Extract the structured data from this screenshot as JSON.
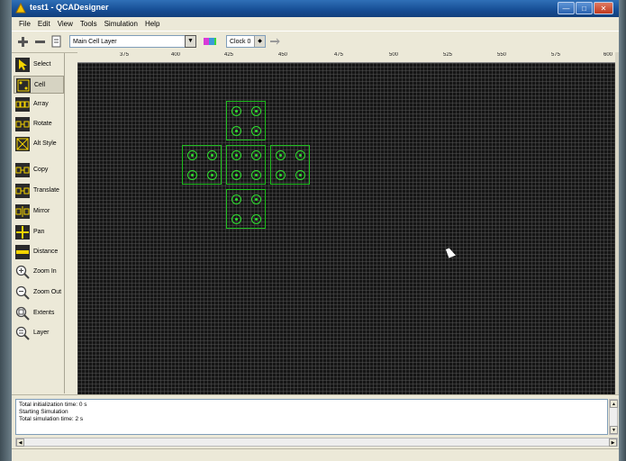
{
  "window": {
    "title": "test1 - QCADesigner",
    "minimize": "—",
    "maximize": "□",
    "close": "✕"
  },
  "menu": [
    "File",
    "Edit",
    "View",
    "Tools",
    "Simulation",
    "Help"
  ],
  "toolbar": {
    "layer": "Main Cell Layer",
    "clock": "Clock 0"
  },
  "tools": [
    {
      "label": "Select",
      "icon": "select-arrow-icon"
    },
    {
      "label": "Cell",
      "icon": "cell-icon",
      "active": true
    },
    {
      "label": "Array",
      "icon": "array-icon"
    },
    {
      "label": "Rotate",
      "icon": "rotate-icon"
    },
    {
      "label": "Alt Style",
      "icon": "alt-style-icon"
    },
    {
      "label": "Copy",
      "icon": "copy-icon"
    },
    {
      "label": "Translate",
      "icon": "translate-icon"
    },
    {
      "label": "Mirror",
      "icon": "mirror-icon"
    },
    {
      "label": "Pan",
      "icon": "pan-icon"
    },
    {
      "label": "Distance",
      "icon": "distance-icon"
    },
    {
      "label": "Zoom In",
      "icon": "zoom-in-icon"
    },
    {
      "label": "Zoom Out",
      "icon": "zoom-out-icon"
    },
    {
      "label": "Extents",
      "icon": "extents-icon"
    },
    {
      "label": "Layer",
      "icon": "layer-icon"
    }
  ],
  "ruler": [
    "375",
    "400",
    "425",
    "450",
    "475",
    "500",
    "525",
    "550",
    "575",
    "600"
  ],
  "log": [
    "Total initialization time: 0 s",
    "Starting Simulation",
    "Total simulation time: 2 s"
  ],
  "colors": {
    "canvas": "#151515",
    "cell": "#1fbf1f",
    "dot": "#2ee02e"
  }
}
